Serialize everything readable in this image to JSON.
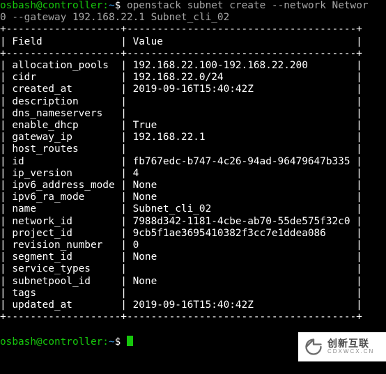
{
  "prompt1": {
    "user": "osbash",
    "at": "@",
    "host": "controller",
    "colon": ":",
    "path": "~",
    "sigil": "$ "
  },
  "command_line1_part1": "openstack subnet create --network Networ",
  "command_line2": "0 --gateway 192.168.22.1 Subnet_cli_02",
  "border_top": "+-------------------+--------------------------------------+",
  "border_mid": "+-------------------+--------------------------------------+",
  "border_bottom": "+-------------------+--------------------------------------+",
  "header_row": "| Field             | Value                                |",
  "rows": [
    "| allocation_pools  | 192.168.22.100-192.168.22.200        |",
    "| cidr              | 192.168.22.0/24                      |",
    "| created_at        | 2019-09-16T15:40:42Z                 |",
    "| description       |                                      |",
    "| dns_nameservers   |                                      |",
    "| enable_dhcp       | True                                 |",
    "| gateway_ip        | 192.168.22.1                         |",
    "| host_routes       |                                      |",
    "| id                | fb767edc-b747-4c26-94ad-96479647b335 |",
    "| ip_version        | 4                                    |",
    "| ipv6_address_mode | None                                 |",
    "| ipv6_ra_mode      | None                                 |",
    "| name              | Subnet_cli_02                        |",
    "| network_id        | 7988d342-1181-4cbe-ab70-55de575f32c0 |",
    "| project_id        | 9cb5f1ae3695410382f3cc7e1ddea086     |",
    "| revision_number   | 0                                    |",
    "| segment_id        | None                                 |",
    "| service_types     |                                      |",
    "| subnetpool_id     | None                                 |",
    "| tags              |                                      |",
    "| updated_at        | 2019-09-16T15:40:42Z                 |"
  ],
  "blank_line": "",
  "prompt2": {
    "user": "osbash",
    "at": "@",
    "host": "controller",
    "colon": ":",
    "path": "~",
    "sigil": "$ "
  },
  "watermark": {
    "cn": "创新互联",
    "py": "CDXWCX.CN"
  }
}
